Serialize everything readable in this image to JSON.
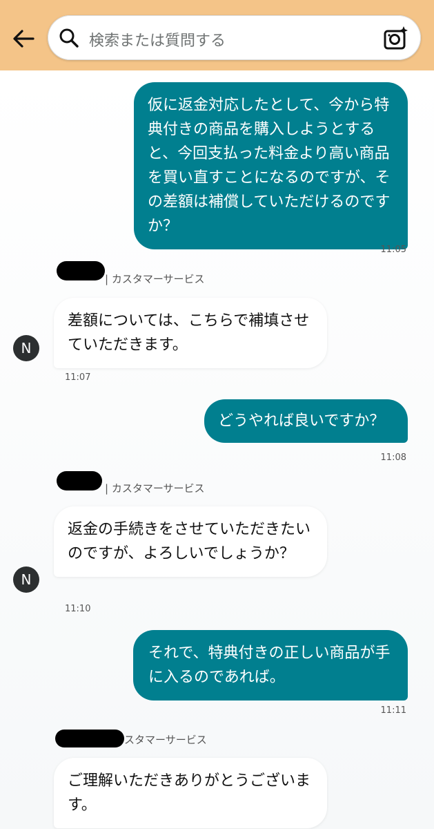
{
  "header": {
    "search_placeholder": "検索または質問する",
    "icons": [
      "back-arrow-icon",
      "search-icon",
      "camera-sparkle-icon"
    ],
    "background_color": "#f4c488"
  },
  "colors": {
    "outgoing_bubble": "#017f8f",
    "incoming_bubble": "#ffffff",
    "avatar": "#2c2f30"
  },
  "messages": [
    {
      "from": "user",
      "text": "仮に返金対応したとして、今から特典付きの商品を購入しようとすると、今回支払った料金より高い商品を買い直すことになるのですが、その差額は補償していただけるのですか？",
      "time": "11:05"
    },
    {
      "from": "agent",
      "agent_label": "| カスタマーサービス",
      "avatar_initial": "N",
      "text": "差額については、こちらで補填させていただきます。",
      "time": "11:07"
    },
    {
      "from": "user",
      "text": "どうやれば良いですか？",
      "time": "11:08"
    },
    {
      "from": "agent",
      "agent_label": "| カスタマーサービス",
      "avatar_initial": "N",
      "text": "返金の手続きをさせていただきたいのですが、よろしいでしょうか？",
      "time": "11:10"
    },
    {
      "from": "user",
      "text": "それで、特典付きの正しい商品が手に入るのであれば。",
      "time": "11:11"
    },
    {
      "from": "agent",
      "agent_label": "スタマーサービス",
      "text": "ご理解いただきありがとうございます。"
    }
  ]
}
